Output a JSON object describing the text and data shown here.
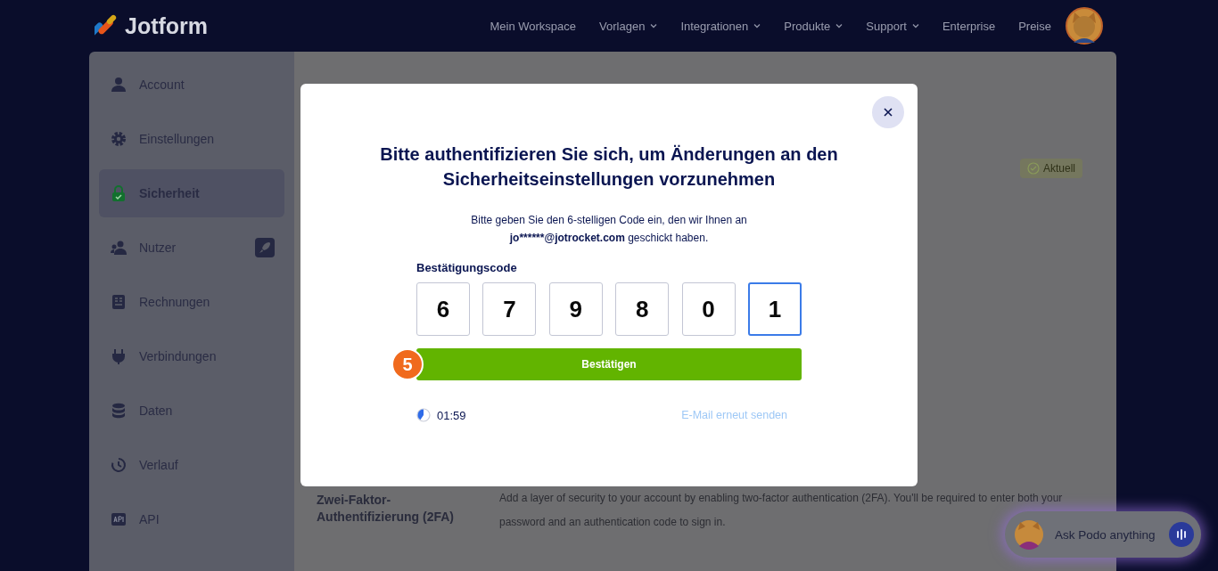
{
  "brand": {
    "name": "Jotform"
  },
  "nav": [
    {
      "label": "Mein Workspace",
      "has_menu": false
    },
    {
      "label": "Vorlagen",
      "has_menu": true
    },
    {
      "label": "Integrationen",
      "has_menu": true
    },
    {
      "label": "Produkte",
      "has_menu": true
    },
    {
      "label": "Support",
      "has_menu": true
    },
    {
      "label": "Enterprise",
      "has_menu": false
    },
    {
      "label": "Preise",
      "has_menu": false
    }
  ],
  "sidebar": {
    "items": [
      {
        "kind": "user",
        "label": "Account",
        "selected": false
      },
      {
        "kind": "gear",
        "label": "Einstellungen",
        "selected": false
      },
      {
        "kind": "lock",
        "label": "Sicherheit",
        "selected": true
      },
      {
        "kind": "users",
        "label": "Nutzer",
        "selected": false,
        "upgrade": true
      },
      {
        "kind": "invoice",
        "label": "Rechnungen",
        "selected": false
      },
      {
        "kind": "plug",
        "label": "Verbindungen",
        "selected": false
      },
      {
        "kind": "database",
        "label": "Daten",
        "selected": false
      },
      {
        "kind": "history",
        "label": "Verlauf",
        "selected": false
      },
      {
        "kind": "api",
        "label": "API",
        "selected": false
      }
    ]
  },
  "page": {
    "status_badge": "Aktuell",
    "section": {
      "label": "Zwei-Faktor-Authentifizierung (2FA)",
      "description": "Add a layer of security to your account by enabling two-factor authentication (2FA). You'll be required to enter both your password and an authentication code to sign in."
    }
  },
  "dialog": {
    "title": "Bitte authentifizieren Sie sich, um Änderungen an den Sicherheitseinstellungen vorzunehmen",
    "message": {
      "before": "Bitte geben Sie den 6-stelligen Code ein, den wir Ihnen an",
      "email": "jo******@jotrocket.com",
      "after": "geschickt haben."
    },
    "code_label": "Bestätigungscode",
    "code_digits": [
      {
        "value": "6",
        "focused": false
      },
      {
        "value": "7",
        "focused": false
      },
      {
        "value": "9",
        "focused": false
      },
      {
        "value": "8",
        "focused": false
      },
      {
        "value": "0",
        "focused": false
      },
      {
        "value": "1",
        "focused": true
      }
    ],
    "step_badge": "5",
    "confirm_button": "Bestätigen",
    "timer": "01:59",
    "resend_link": {
      "label": "E-Mail erneut senden",
      "disabled": true
    }
  },
  "assistant": {
    "placeholder": "Ask Podo anything"
  }
}
